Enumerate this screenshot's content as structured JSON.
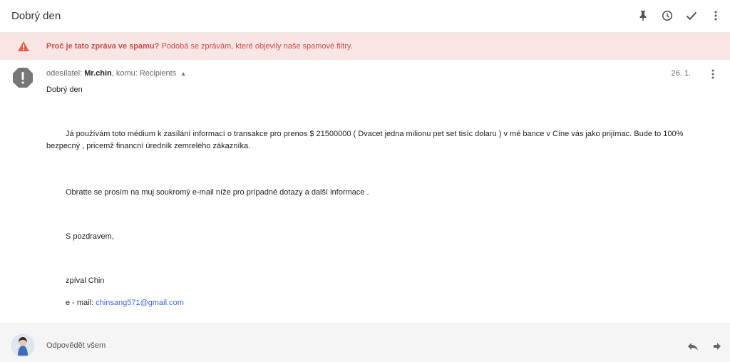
{
  "header": {
    "subject": "Dobrý den",
    "icons": [
      "pin-icon",
      "clock-icon",
      "check-icon",
      "more-vert-icon"
    ]
  },
  "spam_banner": {
    "title": "Proč je tato zpráva ve spamu?",
    "reason": "Podobá se zprávám, které objevily naše spamové filtry."
  },
  "message": {
    "sender_prefix": "odesílatel:",
    "sender": "Mr.chin",
    "to_text": ", komu: Recipients",
    "date": "26. 1.",
    "greeting": "Dobrý den",
    "para1": "Já používám toto médium k zasílání informací o transakce pro prenos $ 21500000 ( Dvacet jedna milionu pet set tisíc dolaru ) v mé bance v Cíne vás jako prijímac. Bude to 100% bezpecný , pricemž financní úredník zemrelého zákazníka.",
    "para2": "Obratte se prosím na muj soukromý e-mail níže pro prípadné dotazy a další informace .",
    "para3": "S pozdravem,",
    "para4": "zpíval Chin",
    "email_prefix": "e - mail: ",
    "email": "chinsang571@gmail.com"
  },
  "footer": {
    "reply_all": "Odpovědět všem"
  },
  "colors": {
    "spam_bg": "#f9e5e3",
    "spam_text": "#c5504a",
    "link": "#3b66c7",
    "warn_icon": "#e85b4a"
  }
}
